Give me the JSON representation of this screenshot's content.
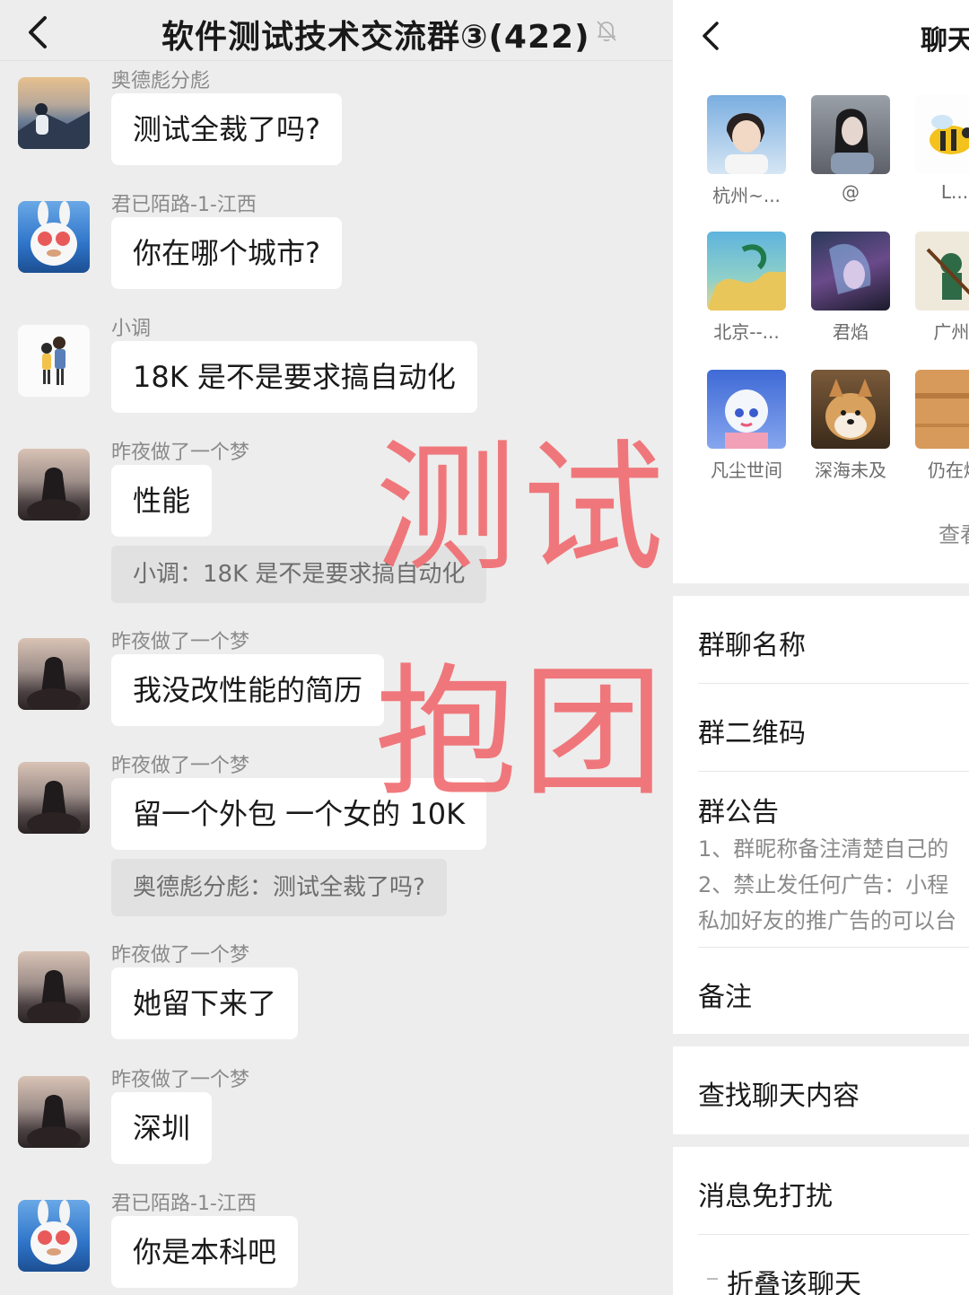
{
  "chat": {
    "title": "软件测试技术交流群③(422)",
    "messages": [
      {
        "sender": "奥德彪分彪",
        "text": "测试全裁了吗?"
      },
      {
        "sender": "君已陌路-1-江西",
        "text": "你在哪个城市?"
      },
      {
        "sender": "小调",
        "text": "18K 是不是要求搞自动化"
      },
      {
        "sender": "昨夜做了一个梦",
        "text": "性能",
        "quote": "小调：18K 是不是要求搞自动化"
      },
      {
        "sender": "昨夜做了一个梦",
        "text": "我没改性能的简历"
      },
      {
        "sender": "昨夜做了一个梦",
        "text": "留一个外包  一个女的 10K",
        "quote": "奥德彪分彪：测试全裁了吗?"
      },
      {
        "sender": "昨夜做了一个梦",
        "text": "她留下来了"
      },
      {
        "sender": "昨夜做了一个梦",
        "text": "深圳"
      },
      {
        "sender": "君已陌路-1-江西",
        "text": "你是本科吧"
      }
    ]
  },
  "watermark": {
    "line1": "测试",
    "line2": "抱团",
    "color": "#f06e72"
  },
  "info": {
    "title": "聊天",
    "members": [
      {
        "name": "杭州~..."
      },
      {
        "name": "@"
      },
      {
        "name": "L..."
      },
      {
        "name": "北京--..."
      },
      {
        "name": "君焰"
      },
      {
        "name": "广州-"
      },
      {
        "name": "凡尘世间"
      },
      {
        "name": "深海未及"
      },
      {
        "name": "仍在燃"
      }
    ],
    "view_more": "查看",
    "group_name_label": "群聊名称",
    "qr_label": "群二维码",
    "notice_label": "群公告",
    "notice_lines": [
      "1、群昵称备注清楚自己的",
      "2、禁止发任何广告：小程",
      "私加好友的推广告的可以台"
    ],
    "remark_label": "备注",
    "search_label": "查找聊天内容",
    "mute_label": "消息免打扰",
    "fold_label": "折叠该聊天"
  }
}
